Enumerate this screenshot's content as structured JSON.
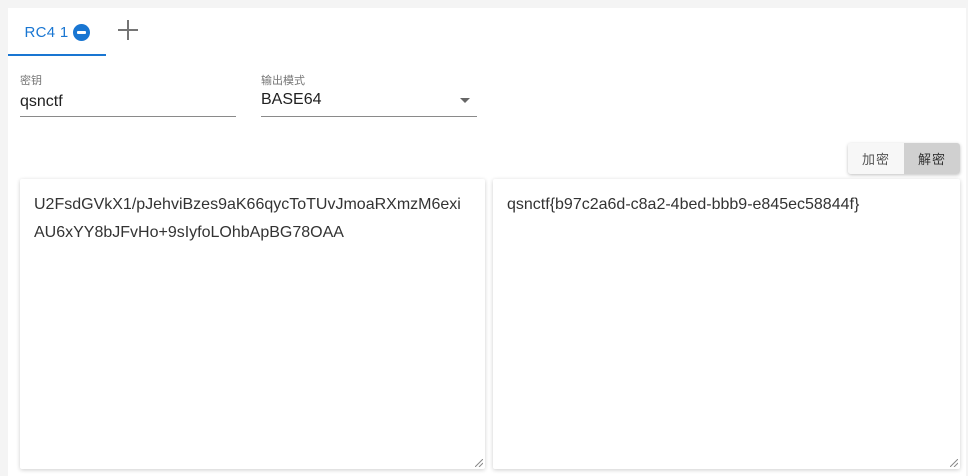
{
  "tabs": [
    {
      "label": "RC4 1"
    }
  ],
  "key_field": {
    "label": "密钥",
    "value": "qsnctf"
  },
  "output_mode": {
    "label": "输出模式",
    "value": "BASE64"
  },
  "actions": {
    "encrypt_label": "加密",
    "decrypt_label": "解密"
  },
  "input_text": "U2FsdGVkX1/pJehviBzes9aK66qycToTUvJmoaRXmzM6exiAU6xYY8bJFvHo+9sIyfoLOhbApBG78OAA",
  "output_text": "qsnctf{b97c2a6d-c8a2-4bed-bbb9-e845ec58844f}",
  "colors": {
    "accent": "#1976d2",
    "active_button": "#d0d0d0"
  }
}
